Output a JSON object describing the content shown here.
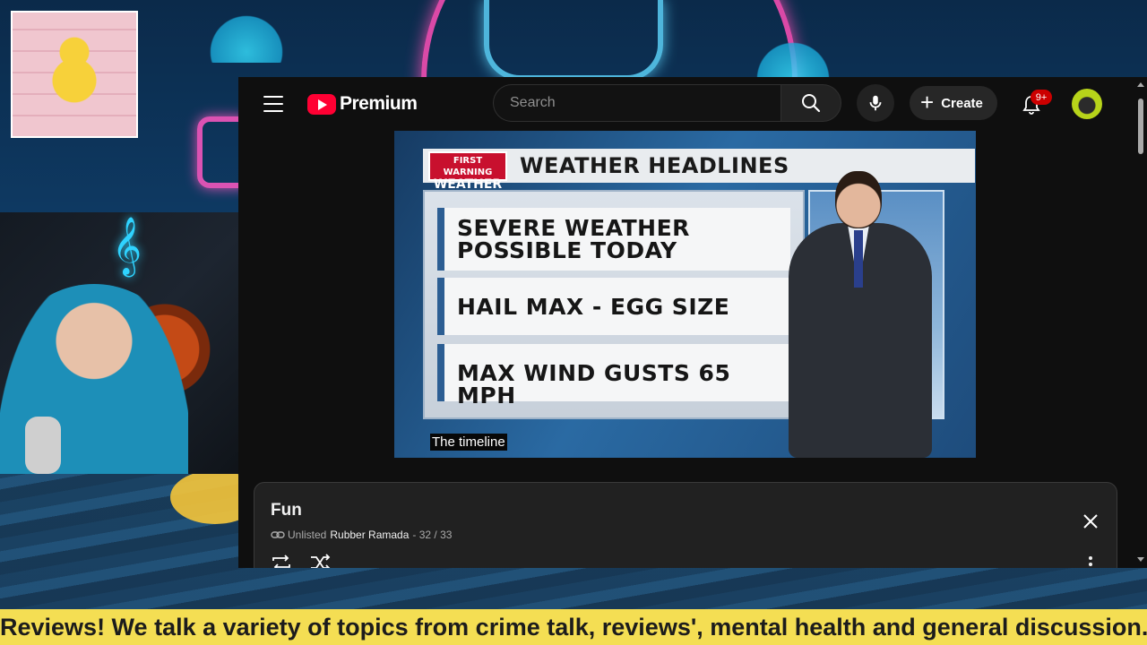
{
  "header": {
    "logo_text": "Premium",
    "search_placeholder": "Search",
    "create_label": "Create",
    "notification_count": "9+"
  },
  "video": {
    "brand_line1": "FIRST WARNING",
    "brand_line2": "WEATHER",
    "title": "WEATHER HEADLINES",
    "headlines": [
      "SEVERE WEATHER POSSIBLE TODAY",
      "HAIL MAX -  EGG SIZE",
      "MAX WIND GUSTS 65 MPH"
    ],
    "caption": "The timeline"
  },
  "playlist": {
    "title": "Fun",
    "visibility": "Unlisted",
    "owner": "Rubber Ramada",
    "position": "- 32 / 33"
  },
  "ticker": {
    "text": "Reviews! We talk a variety of topics from crime talk, reviews', mental health and general discussion. All topic"
  },
  "colors": {
    "youtube_red": "#ff0033",
    "ticker_bg": "#f4de53",
    "badge_red": "#cc0000",
    "fw_red": "#c8102e"
  },
  "icons": {
    "menu": "hamburger-menu-icon",
    "search": "search-icon",
    "mic": "microphone-icon",
    "bell": "bell-icon",
    "close": "close-icon",
    "loop": "loop-icon",
    "shuffle": "shuffle-icon",
    "link": "link-icon",
    "more": "more-vertical-icon"
  }
}
